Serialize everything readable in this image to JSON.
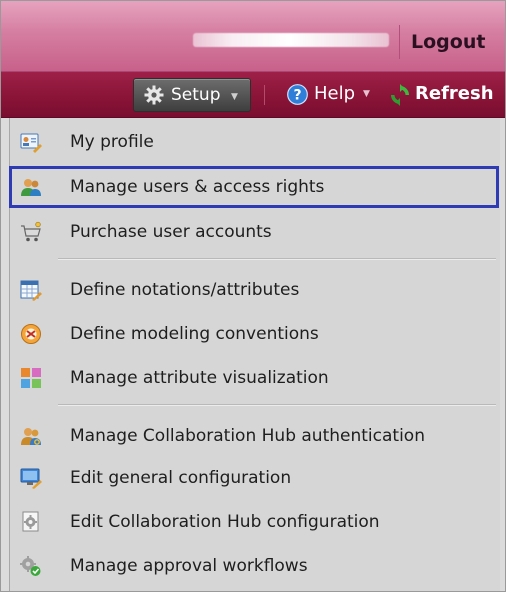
{
  "header": {
    "logout_label": "Logout"
  },
  "toolbar": {
    "setup_label": "Setup",
    "help_label": "Help",
    "refresh_label": "Refresh"
  },
  "menu": {
    "items": [
      {
        "label": "My profile",
        "icon": "profile-card-icon"
      },
      {
        "label": "Manage users & access rights",
        "icon": "users-icon"
      },
      {
        "label": "Purchase user accounts",
        "icon": "cart-icon"
      },
      {
        "label": "Define notations/attributes",
        "icon": "table-edit-icon"
      },
      {
        "label": "Define modeling conventions",
        "icon": "conventions-badge-icon"
      },
      {
        "label": "Manage attribute visualization",
        "icon": "color-grid-icon"
      },
      {
        "label": "Manage Collaboration Hub authentication",
        "icon": "users-key-icon"
      },
      {
        "label": "Edit general configuration",
        "icon": "monitor-edit-icon"
      },
      {
        "label": "Edit Collaboration Hub configuration",
        "icon": "gear-document-icon"
      },
      {
        "label": "Manage approval workflows",
        "icon": "workflow-gears-icon"
      }
    ]
  },
  "colors": {
    "header_pink": "#d57ea1",
    "toolbar_red": "#8a1438",
    "highlight_outline": "#2f3bb4",
    "menu_bg": "#d6d6d6"
  }
}
